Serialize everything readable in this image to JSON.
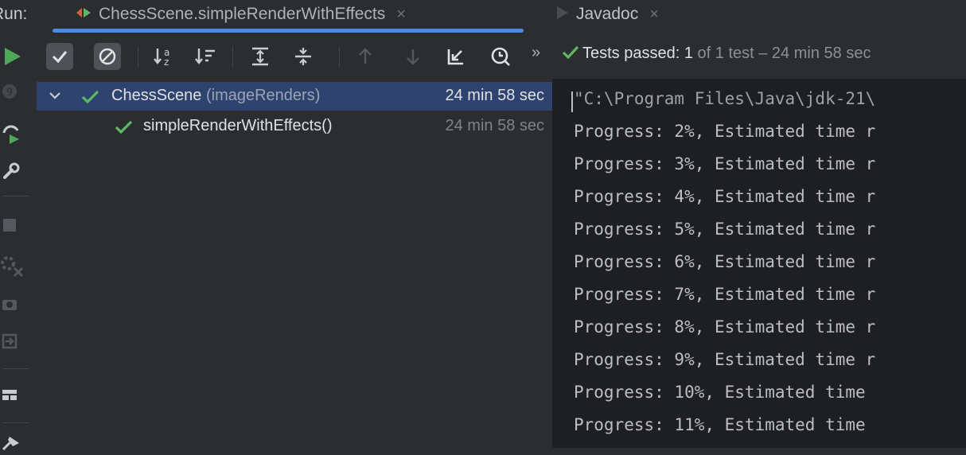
{
  "tabbar": {
    "run_label": "Run:",
    "tabs": [
      {
        "label": "ChessScene.simpleRenderWithEffects",
        "icon": "run-config-icon",
        "active": true,
        "close": "×"
      },
      {
        "label": "Javadoc",
        "icon": "javadoc-icon",
        "active": false,
        "close": "×"
      }
    ]
  },
  "toolbar": {
    "buttons": [
      "show-passed-icon",
      "show-ignored-icon",
      "sort-alphabetically-icon",
      "sort-by-duration-icon",
      "expand-all-icon",
      "collapse-all-icon",
      "previous-failed-icon",
      "next-failed-icon",
      "import-tests-icon",
      "test-history-icon",
      "more-icon"
    ],
    "more": "»",
    "status": {
      "label": "Tests passed:",
      "count": "1",
      "rest": "of 1 test – 24 min 58 sec"
    }
  },
  "tree": {
    "rows": [
      {
        "name": "ChessScene",
        "detail": "(imageRenders)",
        "time": "24 min 58 sec",
        "selected": true
      },
      {
        "name": "simpleRenderWithEffects()",
        "time": "24 min 58 sec",
        "selected": false
      }
    ]
  },
  "console": {
    "lines": [
      "\"C:\\Program Files\\Java\\jdk-21\\",
      "Progress: 2%, Estimated time r",
      "Progress: 3%, Estimated time r",
      "Progress: 4%, Estimated time r",
      "Progress: 5%, Estimated time r",
      "Progress: 6%, Estimated time r",
      "Progress: 7%, Estimated time r",
      "Progress: 8%, Estimated time r",
      "Progress: 9%, Estimated time r",
      "Progress: 10%, Estimated time ",
      "Progress: 11%, Estimated time "
    ]
  },
  "colors": {
    "accent_blue": "#4a8be4",
    "pass_green": "#5fb865",
    "run_green": "#4fa85a",
    "selection": "#2e436e",
    "console_bg": "#1e1f22",
    "panel_bg": "#2b2d30"
  }
}
